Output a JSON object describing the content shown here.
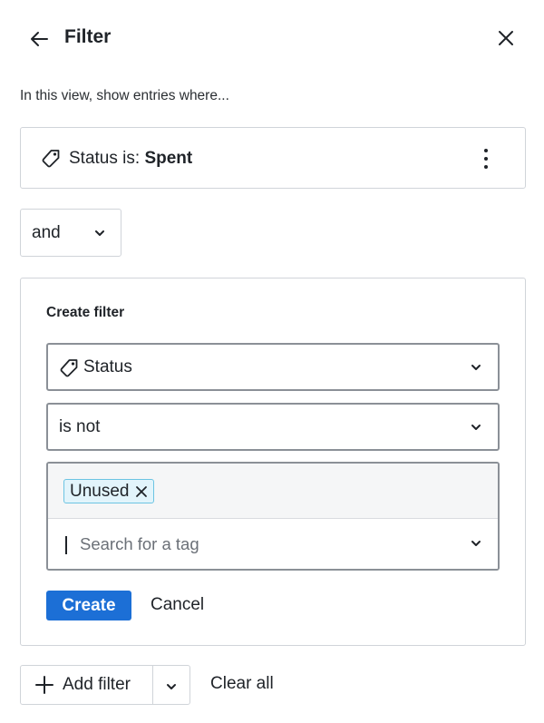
{
  "header": {
    "title": "Filter",
    "back_icon": "arrow-left-icon",
    "close_icon": "close-icon"
  },
  "intro_text": "In this view, show entries where...",
  "existing_filter": {
    "icon": "tag-icon",
    "prefix": "Status is:",
    "value": "Spent",
    "menu_icon": "more-vertical-icon"
  },
  "conjunction": {
    "selected": "and",
    "icon": "chevron-down-icon"
  },
  "create_filter": {
    "heading": "Create filter",
    "field": {
      "icon": "tag-icon",
      "selected": "Status"
    },
    "operator": {
      "selected": "is not"
    },
    "values": {
      "chips": [
        {
          "label": "Unused"
        }
      ],
      "search_placeholder": "Search for a tag"
    },
    "create_label": "Create",
    "cancel_label": "Cancel"
  },
  "footer": {
    "add_filter_label": "Add filter",
    "clear_all_label": "Clear all"
  },
  "colors": {
    "primary": "#1c6fd6",
    "chip_bg": "#e2f4fb",
    "chip_border": "#6cc4e3",
    "border": "#d0d4d9",
    "field_border": "#8b9097"
  }
}
